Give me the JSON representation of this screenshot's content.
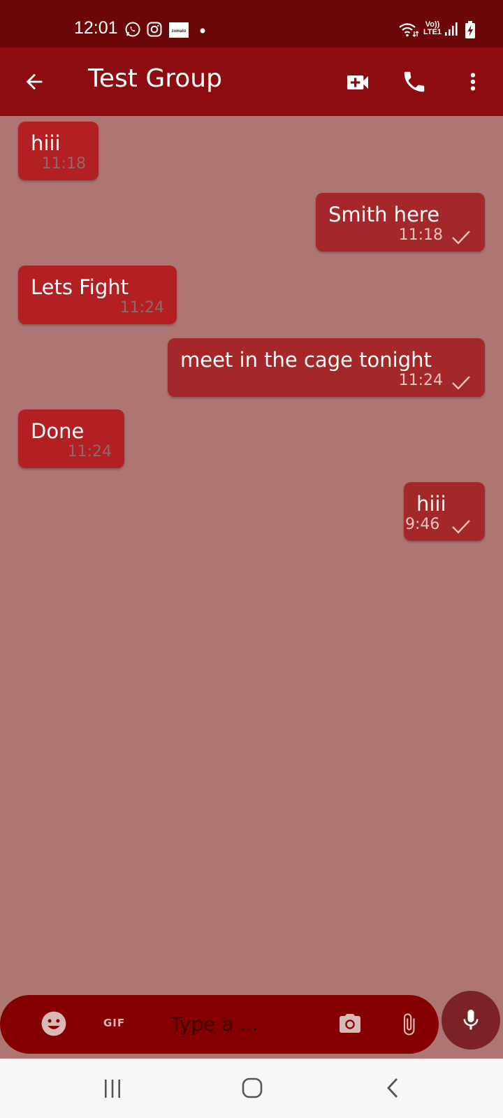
{
  "status_bar": {
    "time": "12:01",
    "icons": [
      "whatsapp-icon",
      "instagram-icon",
      "zomato-icon",
      "dot-icon",
      "wifi-icon",
      "volte-icon",
      "signal-icon",
      "battery-charging-icon"
    ],
    "volte_line1": "Vo))",
    "volte_line2": "LTE1",
    "zomato_text": "zomato"
  },
  "header": {
    "title": "Test Group",
    "icons": [
      "back-arrow-icon",
      "video-call-icon",
      "phone-icon",
      "more-vert-icon"
    ]
  },
  "messages": [
    {
      "direction": "incoming",
      "text": "hiii",
      "time": "11:18"
    },
    {
      "direction": "outgoing",
      "text": "Smith here",
      "time": "11:18",
      "status": "sent"
    },
    {
      "direction": "incoming",
      "text": "Lets Fight",
      "time": "11:24"
    },
    {
      "direction": "outgoing",
      "text": "meet in the cage tonight",
      "time": "11:24",
      "status": "sent"
    },
    {
      "direction": "incoming",
      "text": "Done",
      "time": "11:24"
    },
    {
      "direction": "outgoing",
      "text": "hiii",
      "time": "9:46",
      "status": "sent"
    }
  ],
  "composer": {
    "placeholder": "Type a ...",
    "gif_label": "GIF",
    "icons": [
      "emoji-icon",
      "camera-icon",
      "attach-icon",
      "mic-icon"
    ]
  },
  "nav_bar": {
    "icons": [
      "recents-icon",
      "home-icon",
      "back-icon"
    ]
  },
  "colors": {
    "status_bar": "#6b0709",
    "app_bar": "#8c0c0f",
    "background": "#ae7673",
    "incoming_bubble": "#b32024",
    "outgoing_bubble": "#a4282a",
    "composer": "#850000",
    "mic_button": "#7a2226"
  }
}
